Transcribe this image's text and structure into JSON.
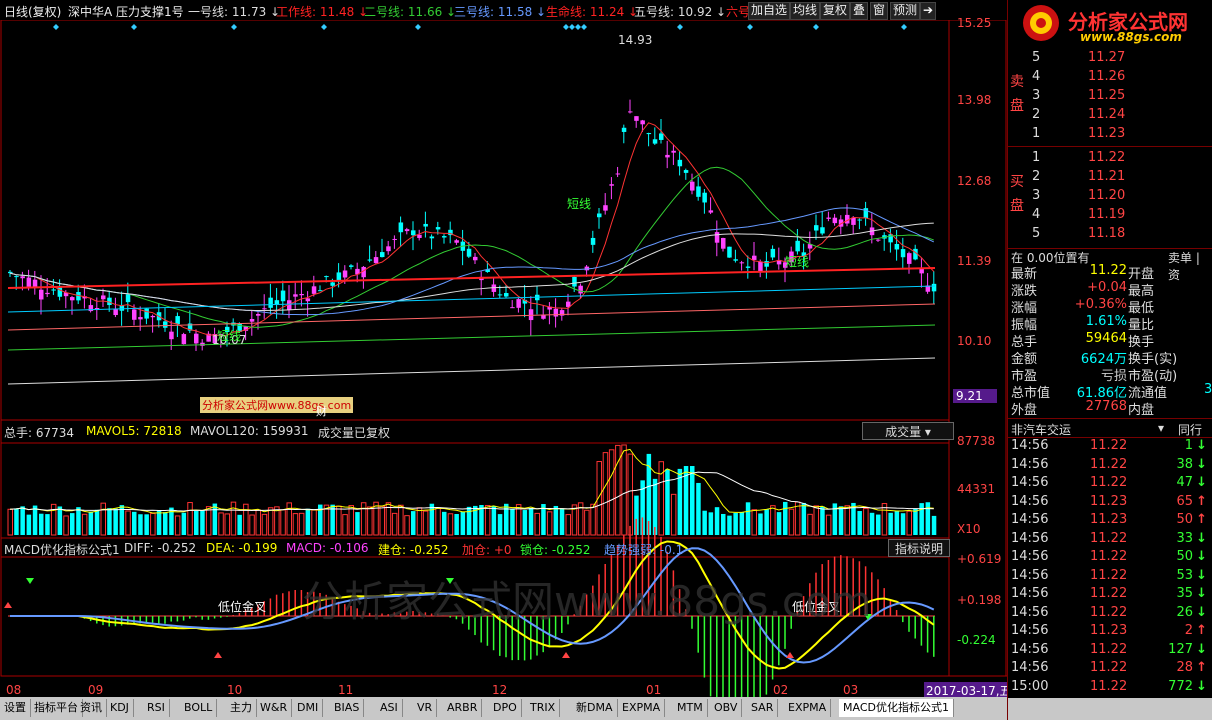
{
  "toolbar": {
    "period": "日线(复权)",
    "stock": "深中华A 压力支撑1号",
    "lines": [
      {
        "label": "一号线: 11.73",
        "color": "#dddddd"
      },
      {
        "label": "工作线: 11.48",
        "color": "#ff2222"
      },
      {
        "label": "二号线: 11.66",
        "color": "#33cc33"
      },
      {
        "label": "三号线: 11.58",
        "color": "#6699ff"
      },
      {
        "label": "生命线: 11.24",
        "color": "#ff2222"
      },
      {
        "label": "五号线: 10.92",
        "color": "#dddddd"
      },
      {
        "label": "六号",
        "color": "#ff2222"
      }
    ],
    "buttons": [
      "加自选",
      "均线",
      "复权",
      "叠",
      "窗",
      "预测"
    ]
  },
  "price_axis": [
    "15.25",
    "13.98",
    "12.68",
    "11.39",
    "10.10",
    "9.21"
  ],
  "price_annotations": {
    "high": "14.93",
    "low": "10.07",
    "short1": "短线",
    "short2": "短线",
    "short3": "短线",
    "watermark_box": "分析家公式网www.88gs.com",
    "cai": "财"
  },
  "volume_header": {
    "total": "总手: 67734",
    "mavol5": "MAVOL5: 72818",
    "mavol120": "MAVOL120: 159931",
    "note": "成交量已复权",
    "select": "成交量"
  },
  "volume_axis": [
    "87738",
    "44331",
    "X10"
  ],
  "macd_header": {
    "name": "MACD优化指标公式1",
    "diff": "DIFF: -0.252",
    "dea": "DEA: -0.199",
    "macd": "MACD: -0.106",
    "jiancang": "建仓: -0.252",
    "jiacang": "加仓: +0",
    "suocang": "锁仓: -0.252",
    "trend": "趋势强弱: -0.1",
    "help": "指标说明"
  },
  "macd_axis": [
    "+0.619",
    "+0.198",
    "-0.224"
  ],
  "macd_labels": [
    "低位金叉",
    "低位金叉"
  ],
  "watermark": "分析家公式网www.88gs.com",
  "x_axis": [
    "08",
    "09",
    "10",
    "11",
    "12",
    "01",
    "02",
    "03"
  ],
  "date_label": "2017-03-17,五",
  "bottom_tabs": [
    "设置",
    "指标平台",
    "资讯",
    "KDJ",
    "RSI",
    "BOLL",
    "主力",
    "W&R",
    "DMI",
    "BIAS",
    "ASI",
    "VR",
    "ARBR",
    "DPO",
    "TRIX",
    "新DMA",
    "EXPMA",
    "MTM",
    "OBV",
    "SAR",
    "EXPMA",
    "MACD优化指标公式1"
  ],
  "logo": {
    "text": "分析家公式网",
    "url": "www.88gs.com"
  },
  "order_book": {
    "sell_label": [
      "卖",
      "盘"
    ],
    "buy_label": [
      "买",
      "盘"
    ],
    "sell": [
      {
        "level": "5",
        "price": "11.27"
      },
      {
        "level": "4",
        "price": "11.26"
      },
      {
        "level": "3",
        "price": "11.25"
      },
      {
        "level": "2",
        "price": "11.24"
      },
      {
        "level": "1",
        "price": "11.23"
      }
    ],
    "buy": [
      {
        "level": "1",
        "price": "11.22"
      },
      {
        "level": "2",
        "price": "11.21"
      },
      {
        "level": "3",
        "price": "11.20"
      },
      {
        "level": "4",
        "price": "11.19"
      },
      {
        "level": "5",
        "price": "11.18"
      }
    ]
  },
  "position_row": {
    "left": "在 0.00位置有",
    "right": "卖单 | 资"
  },
  "stats": [
    {
      "label": "最新",
      "value": "11.22",
      "label2": "开盘",
      "vcolor": "#ffff00"
    },
    {
      "label": "涨跌",
      "value": "+0.04",
      "label2": "最高",
      "vcolor": "#ff4444"
    },
    {
      "label": "涨幅",
      "value": "+0.36%",
      "label2": "最低",
      "vcolor": "#ff4444"
    },
    {
      "label": "振幅",
      "value": "1.61%",
      "label2": "量比",
      "vcolor": "#00ffff"
    },
    {
      "label": "总手",
      "value": "59464",
      "label2": "换手",
      "vcolor": "#ffff00"
    },
    {
      "label": "金额",
      "value": "6624万",
      "label2": "换手(实)",
      "vcolor": "#00ffff"
    },
    {
      "label": "市盈",
      "value": "亏损",
      "label2": "市盈(动)",
      "vcolor": "#cccccc"
    },
    {
      "label": "总市值",
      "value": "61.86亿",
      "label2": "流通值",
      "vcolor": "#00ffff"
    },
    {
      "label": "外盘",
      "value": "27768",
      "label2": "内盘",
      "vcolor": "#ff4444"
    }
  ],
  "stats_extra": "3",
  "trade_header": {
    "left": "非汽车交运",
    "right": "同行"
  },
  "trades": [
    {
      "time": "14:56",
      "price": "11.22",
      "vol": "1",
      "dir": "down"
    },
    {
      "time": "14:56",
      "price": "11.22",
      "vol": "38",
      "dir": "down"
    },
    {
      "time": "14:56",
      "price": "11.22",
      "vol": "47",
      "dir": "down"
    },
    {
      "time": "14:56",
      "price": "11.23",
      "vol": "65",
      "dir": "up"
    },
    {
      "time": "14:56",
      "price": "11.23",
      "vol": "50",
      "dir": "up"
    },
    {
      "time": "14:56",
      "price": "11.22",
      "vol": "33",
      "dir": "down"
    },
    {
      "time": "14:56",
      "price": "11.22",
      "vol": "50",
      "dir": "down"
    },
    {
      "time": "14:56",
      "price": "11.22",
      "vol": "53",
      "dir": "down"
    },
    {
      "time": "14:56",
      "price": "11.22",
      "vol": "35",
      "dir": "down"
    },
    {
      "time": "14:56",
      "price": "11.22",
      "vol": "26",
      "dir": "down"
    },
    {
      "time": "14:56",
      "price": "11.23",
      "vol": "2",
      "dir": "up"
    },
    {
      "time": "14:56",
      "price": "11.22",
      "vol": "127",
      "dir": "down"
    },
    {
      "time": "14:56",
      "price": "11.22",
      "vol": "28",
      "dir": "up"
    },
    {
      "time": "15:00",
      "price": "11.22",
      "vol": "772",
      "dir": "down"
    }
  ],
  "colors": {
    "up": "#ff3333",
    "down": "#00ffff",
    "frame": "#aa0000"
  }
}
